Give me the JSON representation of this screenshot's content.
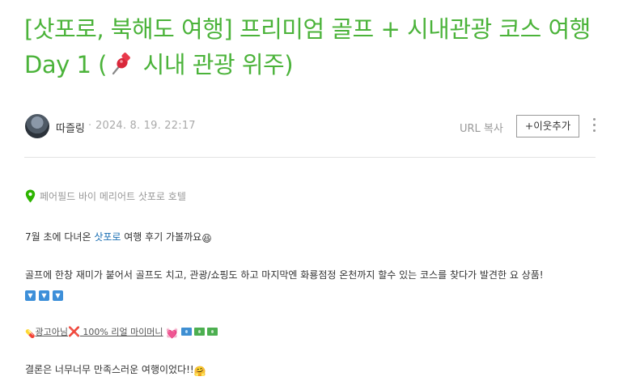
{
  "post": {
    "title_part1": "[삿포로, 북해도 여행] 프리미엄 골프 + 시내관광 코스 여행 Day 1 (",
    "title_pin_icon": "pushpin-icon",
    "title_part2": " 시내 관광 위주)",
    "title_color": "#4bb33a"
  },
  "author": {
    "name": "따즐링",
    "separator": "·",
    "date": "2024. 8. 19. 22:17",
    "avatar_icon": "avatar"
  },
  "actions": {
    "url_copy": "URL 복사",
    "add_neighbor": "+이웃추가",
    "more_icon": "more-vertical-icon"
  },
  "place": {
    "icon": "location-pin-icon",
    "name": "페어필드 바이 메리어트 삿포로 호텔",
    "icon_color": "#2db400"
  },
  "content": {
    "p1_before": "7월 초에 다녀온 ",
    "p1_link": "삿포로",
    "p1_after": " 여행 후기 가볼까요",
    "p1_emoji": "😆",
    "p2": "골프에 한창 재미가 붙어서 골프도 치고, 관광/쇼핑도 하고 마지막엔 화룡점정 온천까지 할수 있는 코스를 찾다가 발견한 요 상품!",
    "p2_arrows": [
      "▼",
      "▼",
      "▼"
    ],
    "p3_pill": "💊",
    "p3_text1": "광고아님",
    "p3_cross": "❌",
    "p3_text2": " 100% 리얼 마이머니",
    "p3_heart": "💓",
    "p4": "결론은 너무너무 만족스러운 여행이었다!!",
    "p4_emoji": "🤗"
  }
}
